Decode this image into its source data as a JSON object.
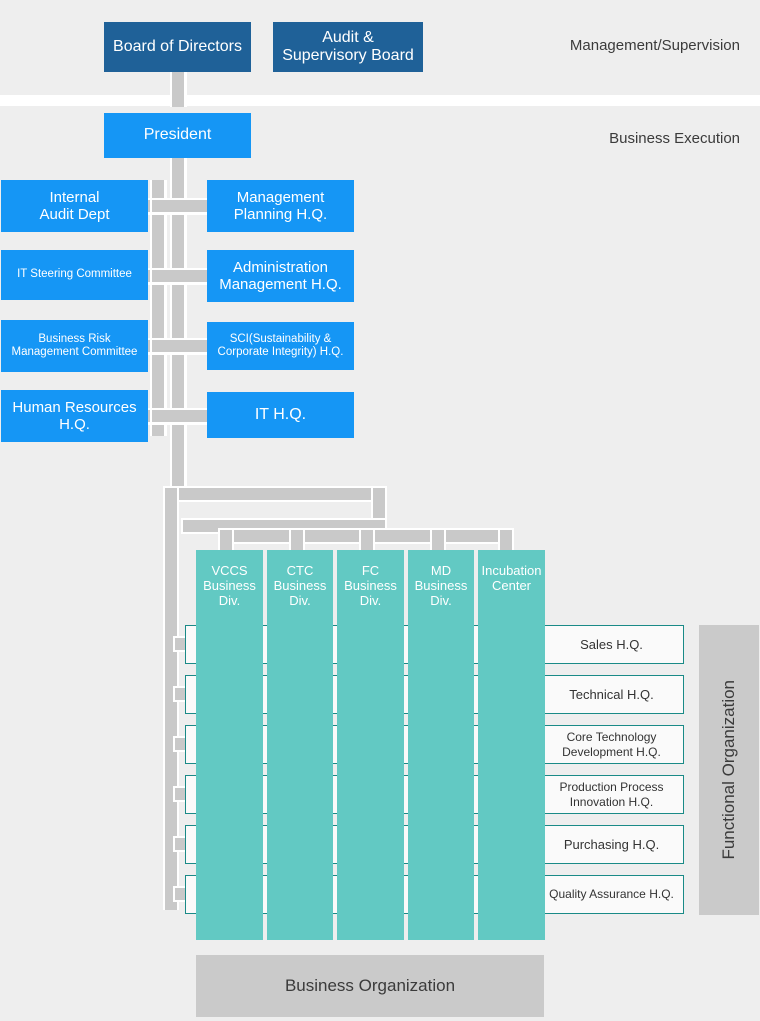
{
  "zones": {
    "management": "Management/Supervision",
    "execution": "Business Execution",
    "functional": "Functional Organization",
    "business": "Business Organization"
  },
  "top": {
    "board": "Board of Directors",
    "audit": "Audit &\nSupervisory Board",
    "audit_line1": "Audit &",
    "audit_line2": "Supervisory Board",
    "president": "President"
  },
  "left_column": [
    {
      "line1": "Internal",
      "line2": "Audit Dept",
      "size": "large"
    },
    {
      "line1": "IT Steering Committee",
      "line2": "",
      "size": "small"
    },
    {
      "line1": "Business Risk",
      "line2": "Management Committee",
      "size": "small"
    },
    {
      "line1": "Human Resources",
      "line2": "H.Q.",
      "size": "large"
    }
  ],
  "right_column": [
    {
      "line1": "Management",
      "line2": "Planning H.Q.",
      "size": "large"
    },
    {
      "line1": "Administration",
      "line2": "Management H.Q.",
      "size": "large"
    },
    {
      "line1": "SCI(Sustainability &",
      "line2": "Corporate Integrity) H.Q.",
      "size": "small"
    },
    {
      "line1": "IT H.Q.",
      "line2": "",
      "size": "large"
    }
  ],
  "divisions": [
    {
      "line1": "VCCS",
      "line2": "Business",
      "line3": "Div."
    },
    {
      "line1": "CTC",
      "line2": "Business",
      "line3": "Div."
    },
    {
      "line1": "FC",
      "line2": "Business",
      "line3": "Div."
    },
    {
      "line1": "MD",
      "line2": "Business",
      "line3": "Div."
    },
    {
      "line1": "Incubation",
      "line2": "Center",
      "line3": ""
    }
  ],
  "functional_hq": [
    {
      "line1": "Sales H.Q.",
      "line2": ""
    },
    {
      "line1": "Technical H.Q.",
      "line2": ""
    },
    {
      "line1": "Core Technology",
      "line2": "Development H.Q."
    },
    {
      "line1": "Production Process",
      "line2": "Innovation H.Q."
    },
    {
      "line1": "Purchasing H.Q.",
      "line2": ""
    },
    {
      "line1": "Quality Assurance H.Q.",
      "line2": ""
    }
  ],
  "colors": {
    "navy": "#1f6198",
    "blue": "#1596f5",
    "teal": "#62c9c3",
    "teal_border": "#1a8a87",
    "background": "#eeeeee",
    "connector": "#c9c9c9",
    "panel": "#cacaca"
  }
}
